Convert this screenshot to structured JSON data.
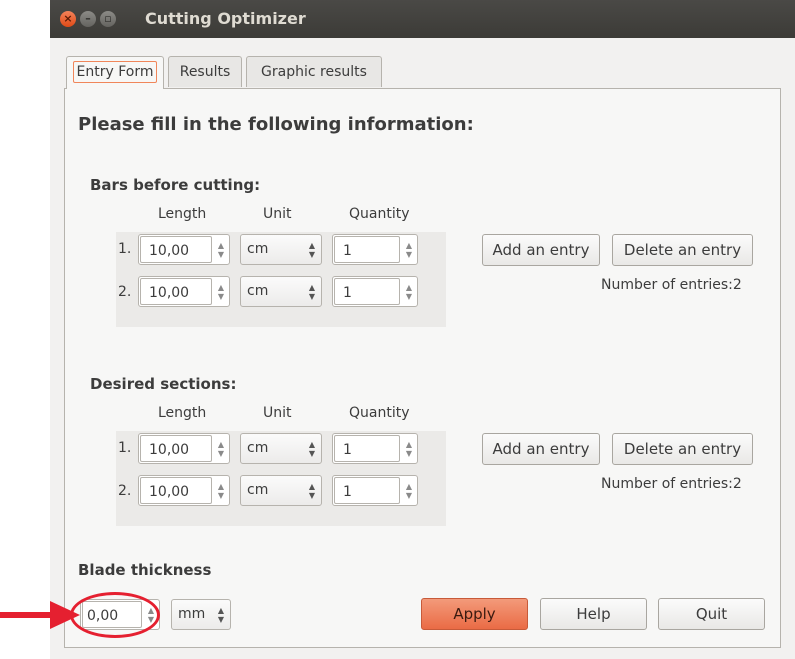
{
  "window": {
    "title": "Cutting Optimizer"
  },
  "tabs": [
    {
      "label": "Entry Form"
    },
    {
      "label": "Results"
    },
    {
      "label": "Graphic results"
    }
  ],
  "form": {
    "heading": "Please fill in the following information:",
    "columns": {
      "length": "Length",
      "unit": "Unit",
      "quantity": "Quantity"
    },
    "bars": {
      "title": "Bars before cutting:",
      "rows": [
        {
          "num": "1.",
          "length": "10,00",
          "unit": "cm",
          "quantity": "1"
        },
        {
          "num": "2.",
          "length": "10,00",
          "unit": "cm",
          "quantity": "1"
        }
      ],
      "add_label": "Add an entry",
      "delete_label": "Delete an entry",
      "count_label": "Number of entries:2"
    },
    "sections": {
      "title": "Desired sections:",
      "rows": [
        {
          "num": "1.",
          "length": "10,00",
          "unit": "cm",
          "quantity": "1"
        },
        {
          "num": "2.",
          "length": "10,00",
          "unit": "cm",
          "quantity": "1"
        }
      ],
      "add_label": "Add an entry",
      "delete_label": "Delete an entry",
      "count_label": "Number of entries:2"
    },
    "blade": {
      "title": "Blade thickness",
      "value": "0,00",
      "unit": "mm"
    }
  },
  "buttons": {
    "apply": "Apply",
    "help": "Help",
    "quit": "Quit"
  },
  "colors": {
    "accent": "#ea6b45",
    "annotation": "#e52030"
  }
}
